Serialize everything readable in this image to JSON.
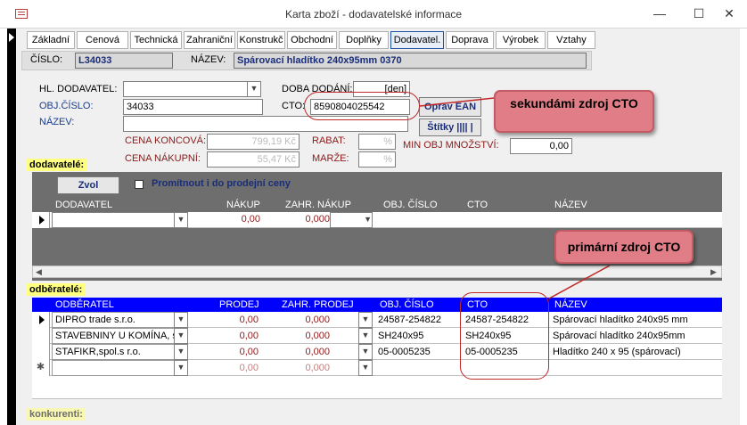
{
  "window": {
    "title": "Karta zboží - dodavatelské informace",
    "minimize_glyph": "—",
    "maximize_glyph": "☐",
    "close_glyph": "✕"
  },
  "tabs": [
    "Základní",
    "Cenová",
    "Technická",
    "Zahraniční",
    "Konstrukč",
    "Obchodní",
    "Doplňky",
    "Dodavatel.",
    "Doprava",
    "Výrobek",
    "Vztahy"
  ],
  "active_tab": "Dodavatel.",
  "header": {
    "cislo_label": "ČÍSLO:",
    "cislo_value": "L34033",
    "nazev_label": "NÁZEV:",
    "nazev_value": "Spárovací hladítko 240x95mm 0370"
  },
  "form": {
    "hl_dodavatel_label": "HL. DODAVATEL:",
    "hl_dodavatel_value": "",
    "obj_cislo_label": "OBJ.ČÍSLO:",
    "obj_cislo_value": "34033",
    "nazev_label": "NÁZEV:",
    "nazev_value": "",
    "doba_dodani_label": "DOBA DODÁNÍ:",
    "doba_dodani_unit": "[den]",
    "cto_label": "CTO:",
    "cto_value": "8590804025542",
    "oprav_ean_button": "Oprav EAN",
    "stitky_button": "Štítky |||| |",
    "cena_koncova_label": "CENA KONCOVÁ:",
    "cena_koncova_value": "799,19 Kč",
    "cena_nakupni_label": "CENA NÁKUPNÍ:",
    "cena_nakupni_value": "55,47 Kč",
    "rabat_label": "RABAT:",
    "rabat_value": "%",
    "marze_label": "MARŽE:",
    "marze_value": "%",
    "min_obj_label": "MIN OBJ MNOŽSTVÍ:",
    "min_obj_value": "0,00"
  },
  "dodavatele": {
    "section_label": "dodavatelé:",
    "zvol_button": "Zvol",
    "checkbox_label": "Promítnout i do prodejní ceny",
    "checkbox_checked": false,
    "columns": [
      "DODAVATEL",
      "NÁKUP",
      "ZAHR. NÁKUP",
      "OBJ. ČÍSLO",
      "CTO",
      "NÁZEV"
    ],
    "new_row": {
      "nakup": "0,00",
      "zahr_nakup": "0,000"
    }
  },
  "odberatele": {
    "section_label": "odběratelé:",
    "columns": [
      "ODBĚRATEL",
      "PRODEJ",
      "ZAHR. PRODEJ",
      "OBJ. ČÍSLO",
      "CTO",
      "NÁZEV"
    ],
    "rows": [
      {
        "odberatel": "DIPRO trade s.r.o.",
        "prodej": "0,00",
        "zahr_prodej": "0,000",
        "obj_cislo": "24587-254822",
        "cto": "24587-254822",
        "nazev": "Spárovací hladítko 240x95 mm"
      },
      {
        "odberatel": "STAVEBNINY U KOMÍNA, s",
        "prodej": "0,00",
        "zahr_prodej": "0,000",
        "obj_cislo": "SH240x95",
        "cto": "SH240x95",
        "nazev": "Spárovací hladítko 240x95mm"
      },
      {
        "odberatel": "STAFIKR,spol.s r.o.",
        "prodej": "0,00",
        "zahr_prodej": "0,000",
        "obj_cislo": "05-0005235",
        "cto": "05-0005235",
        "nazev": "Hladítko 240 x 95 (spárovací)"
      }
    ],
    "new_row": {
      "prodej": "0,00",
      "zahr_prodej": "0,000"
    },
    "new_row_marker": "✱"
  },
  "konkurenti_label": "konkurenti:",
  "callouts": {
    "secondary": "sekundámi zdroj CTO",
    "primary": "primární zdroj CTO"
  },
  "colors": {
    "odberatele_header": "#0000ff",
    "callout_fill": "#e07d86",
    "oval_stroke": "#c0282a",
    "section_label_bg": "#ffff80"
  }
}
